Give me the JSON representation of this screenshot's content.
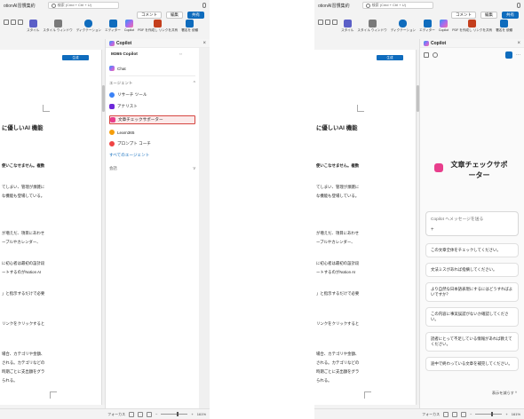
{
  "window": {
    "doc_title": "otionAI習慣集約",
    "search_hint": "検索 (Cmd + Ctrl + U)"
  },
  "toolbar": {
    "comment_label": "コメント",
    "edit_label": "編集",
    "share_label": "共有",
    "ribbon": [
      {
        "label": "スタイル",
        "icon": "styles-icon",
        "color": "#5b5fc7"
      },
      {
        "label": "スタイル ウィンドウ",
        "icon": "styles-pane-icon",
        "color": "#7a7a7a"
      },
      {
        "label": "ディクテーション",
        "icon": "microphone-icon",
        "color": "#0f6cbd"
      },
      {
        "label": "エディター",
        "icon": "editor-icon",
        "color": "#0f6cbd"
      },
      {
        "label": "Copilot",
        "icon": "copilot-icon",
        "color": "#a36bf0"
      },
      {
        "label": "PDF を作成し リンクを共有",
        "icon": "pdf-icon",
        "color": "#c43e1c"
      },
      {
        "label": "署名を 依頼",
        "icon": "sign-icon",
        "color": "#0f6cbd"
      }
    ]
  },
  "document": {
    "button_label": "生成",
    "lines": [
      {
        "text": "に優しいAI 機能",
        "style": "heading"
      },
      {
        "text": "使いこなせません。複数",
        "style": "bold"
      },
      {
        "text": "てしまい、管理が煩雑に",
        "style": "normal"
      },
      {
        "text": "な機能も登場している。",
        "style": "normal"
      },
      {
        "text": "が増えだ、項目にあわせ",
        "style": "normal"
      },
      {
        "text": "ーブルやカレンダー、",
        "style": "normal"
      },
      {
        "text": "に初心者は最初の設計段",
        "style": "normal"
      },
      {
        "text": "ートするのがNotion AI",
        "style": "normal"
      },
      {
        "text": "」と指示するだけで必要",
        "style": "normal"
      },
      {
        "text": "リンクをクリックすると",
        "style": "normal"
      },
      {
        "text": "場合、カテゴリや金額、",
        "style": "normal"
      },
      {
        "text": "される。カテゴリなどの",
        "style": "normal"
      },
      {
        "text": "時期ごとに支出額をグラ",
        "style": "normal"
      },
      {
        "text": "られる。",
        "style": "normal"
      }
    ]
  },
  "copilot": {
    "title": "Copilot",
    "close_glyph": "×"
  },
  "left_panel": {
    "source_label": "M365 Copilot",
    "chat_label": "Chat",
    "agents_header": "エージェント",
    "agents": [
      {
        "label": "リサーチ ツール",
        "icon": "research-icon",
        "color": "#3b82f6"
      },
      {
        "label": "アナリスト",
        "icon": "analyst-icon",
        "color": "#6d28d9"
      },
      {
        "label": "文章チェックサポーター",
        "icon": "agent-icon",
        "color": "#e83e8c",
        "highlight": true
      },
      {
        "label": "Learn365",
        "icon": "learn-icon",
        "color": "#f59e0b"
      },
      {
        "label": "プロンプト コーチ",
        "icon": "coach-icon",
        "color": "#ef4444"
      }
    ],
    "all_agents_link": "すべてのエージェント",
    "history_label": "会話"
  },
  "right_panel": {
    "agent_name": "文章チェックサポーター",
    "input_placeholder": "Copilot へメッセージを送る",
    "prompts": [
      "この文章全体をチェックしてください。",
      "文法ミスがあれば指摘してください。",
      "より自然な日本語表現にするにはどうすればよいですか？",
      "この内容に事実誤認がないか確認してください。",
      "読者にとって不足している情報があれば教えてください。",
      "途中で終わっている文章を補完してください。"
    ],
    "show_less": "表示を減らす ^"
  },
  "status": {
    "focus_label": "フォーカス",
    "zoom": "161%"
  }
}
